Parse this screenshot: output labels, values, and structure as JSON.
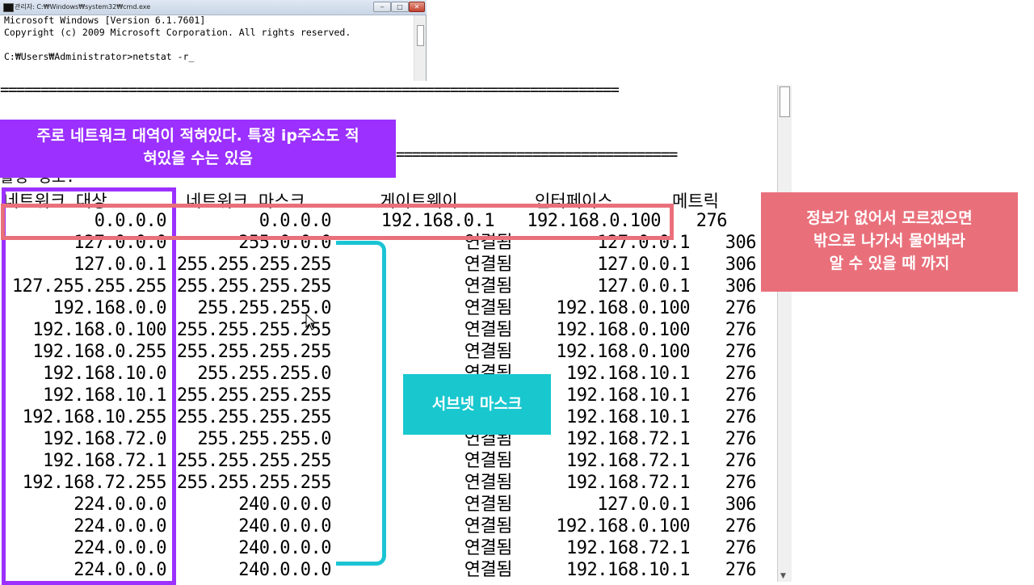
{
  "cmd_window": {
    "title": "관리자: C:₩Windows₩system32₩cmd.exe",
    "lines": [
      "Microsoft Windows [Version 6.1.7601]",
      "Copyright (c) 2009 Microsoft Corporation. All rights reserved.",
      "",
      "C:₩Users₩Administrator>netstat -r_"
    ],
    "buttons": {
      "minimize": "‒",
      "maximize": "□",
      "close": "✕"
    }
  },
  "console": {
    "separator": "=============================================================================",
    "separator_short": "===================================",
    "partial_heading": "활성 경로:",
    "headers": {
      "destination": "네트워크 대상",
      "netmask": "네트워크 마스크",
      "gateway": "게이트웨이",
      "interface": "인터페이스",
      "metric": "메트릭"
    },
    "default_route": {
      "destination": "0.0.0.0",
      "netmask": "0.0.0.0",
      "gateway": "192.168.0.1",
      "interface": "192.168.0.100",
      "metric": "276"
    },
    "routes": [
      {
        "destination": "127.0.0.0",
        "netmask": "255.0.0.0",
        "gateway": "연결됨",
        "interface": "127.0.0.1",
        "metric": "306"
      },
      {
        "destination": "127.0.0.1",
        "netmask": "255.255.255.255",
        "gateway": "연결됨",
        "interface": "127.0.0.1",
        "metric": "306"
      },
      {
        "destination": "127.255.255.255",
        "netmask": "255.255.255.255",
        "gateway": "연결됨",
        "interface": "127.0.0.1",
        "metric": "306"
      },
      {
        "destination": "192.168.0.0",
        "netmask": "255.255.255.0",
        "gateway": "연결됨",
        "interface": "192.168.0.100",
        "metric": "276"
      },
      {
        "destination": "192.168.0.100",
        "netmask": "255.255.255.255",
        "gateway": "연결됨",
        "interface": "192.168.0.100",
        "metric": "276"
      },
      {
        "destination": "192.168.0.255",
        "netmask": "255.255.255.255",
        "gateway": "연결됨",
        "interface": "192.168.0.100",
        "metric": "276"
      },
      {
        "destination": "192.168.10.0",
        "netmask": "255.255.255.0",
        "gateway": "연결됨",
        "interface": "192.168.10.1",
        "metric": "276"
      },
      {
        "destination": "192.168.10.1",
        "netmask": "255.255.255.255",
        "gateway": "연결됨",
        "interface": "192.168.10.1",
        "metric": "276"
      },
      {
        "destination": "192.168.10.255",
        "netmask": "255.255.255.255",
        "gateway": "연결됨",
        "interface": "192.168.10.1",
        "metric": "276"
      },
      {
        "destination": "192.168.72.0",
        "netmask": "255.255.255.0",
        "gateway": "연결됨",
        "interface": "192.168.72.1",
        "metric": "276"
      },
      {
        "destination": "192.168.72.1",
        "netmask": "255.255.255.255",
        "gateway": "연결됨",
        "interface": "192.168.72.1",
        "metric": "276"
      },
      {
        "destination": "192.168.72.255",
        "netmask": "255.255.255.255",
        "gateway": "연결됨",
        "interface": "192.168.72.1",
        "metric": "276"
      },
      {
        "destination": "224.0.0.0",
        "netmask": "240.0.0.0",
        "gateway": "연결됨",
        "interface": "127.0.0.1",
        "metric": "306"
      },
      {
        "destination": "224.0.0.0",
        "netmask": "240.0.0.0",
        "gateway": "연결됨",
        "interface": "192.168.0.100",
        "metric": "276"
      },
      {
        "destination": "224.0.0.0",
        "netmask": "240.0.0.0",
        "gateway": "연결됨",
        "interface": "192.168.72.1",
        "metric": "276"
      },
      {
        "destination": "224.0.0.0",
        "netmask": "240.0.0.0",
        "gateway": "연결됨",
        "interface": "192.168.10.1",
        "metric": "276"
      }
    ]
  },
  "annotations": {
    "purple_note": [
      "주로 네트워크 대역이 적혀있다. 특정 ip주소도 적",
      "혀있을 수는 있음"
    ],
    "red_note": [
      "정보가 없어서 모르겠으면",
      "밖으로 나가서 물어봐라",
      "알 수 있을 때 까지"
    ],
    "teal_note": "서브넷 마스크"
  },
  "colors": {
    "purple": "#9b30ff",
    "red": "#e9707b",
    "teal": "#19c7cf"
  }
}
